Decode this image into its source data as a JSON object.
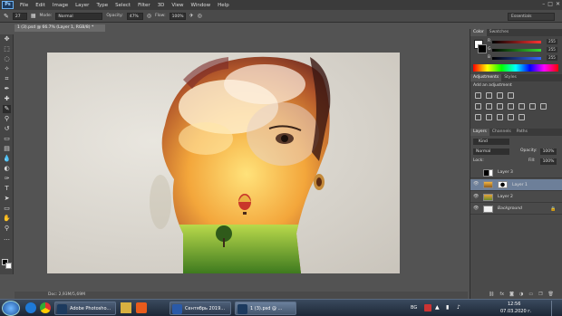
{
  "app": {
    "logo": "Ps"
  },
  "menu": [
    "File",
    "Edit",
    "Image",
    "Layer",
    "Type",
    "Select",
    "Filter",
    "3D",
    "View",
    "Window",
    "Help"
  ],
  "options": {
    "brush_size": "27",
    "mode_label": "Mode:",
    "mode_value": "Normal",
    "opacity_label": "Opacity:",
    "opacity_value": "47%",
    "flow_label": "Flow:",
    "flow_value": "100%"
  },
  "workspace": "Essentials",
  "document_tab": "1 (3).psd @ 66.7% (Layer 1, RGB/8) *",
  "status": "Doc: 2,93M/5,69M",
  "color_panel": {
    "tabs": [
      "Color",
      "Swatches"
    ],
    "sliders": [
      {
        "label": "R",
        "value": "255",
        "color": "#d33"
      },
      {
        "label": "G",
        "value": "255",
        "color": "#3b3"
      },
      {
        "label": "B",
        "value": "255",
        "color": "#36c"
      }
    ]
  },
  "adjustments": {
    "tabs": [
      "Adjustments",
      "Styles"
    ],
    "heading": "Add an adjustment"
  },
  "layers_panel": {
    "tabs": [
      "Layers",
      "Channels",
      "Paths"
    ],
    "kind": "Kind",
    "blend": "Normal",
    "opacity_label": "Opacity:",
    "opacity_value": "100%",
    "lock_label": "Lock:",
    "fill_label": "Fill:",
    "fill_value": "100%",
    "layers": [
      "Layer 3",
      "Layer 1",
      "Layer 2",
      "Background"
    ]
  },
  "taskbar": {
    "items": [
      "Adobe Photosho...",
      "Сентябрь 2019...",
      "1 (3).psd @ ..."
    ],
    "lang": "BG",
    "time": "12:56",
    "date": "07.03.2020 г."
  }
}
